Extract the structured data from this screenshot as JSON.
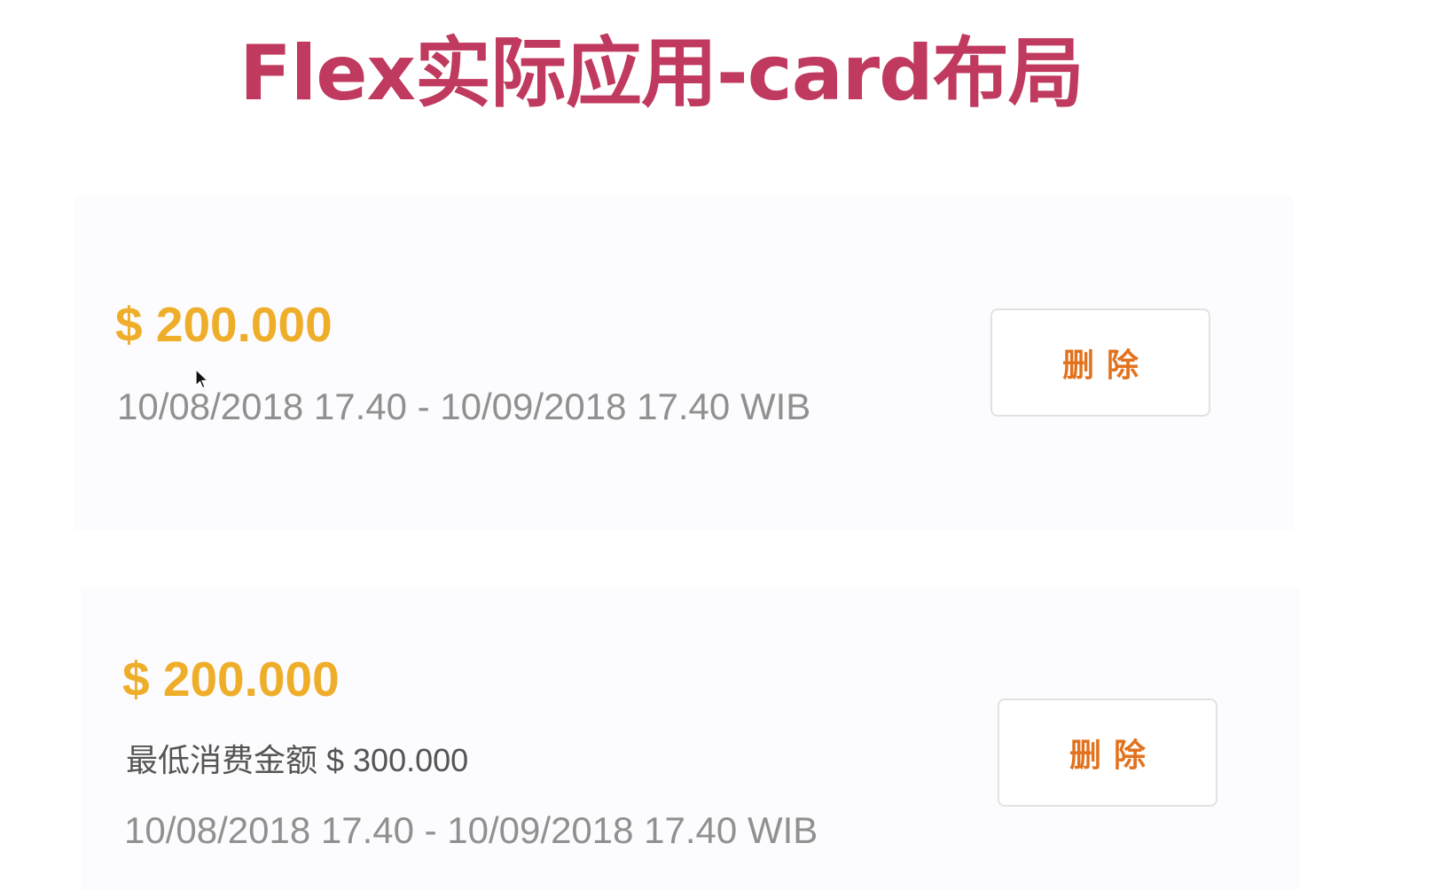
{
  "header": {
    "title": "Flex实际应用-card布局"
  },
  "cards": [
    {
      "price": "$ 200.000",
      "date_range": "10/08/2018 17.40 - 10/09/2018 17.40 WIB",
      "delete_label": "删除"
    },
    {
      "price": "$ 200.000",
      "min_spend": "最低消费金额 $ 300.000",
      "date_range": "10/08/2018 17.40 - 10/09/2018 17.40 WIB",
      "delete_label": "删除"
    }
  ],
  "colors": {
    "title": "#c0395e",
    "price": "#eeae2a",
    "button_text": "#e2721d",
    "card_background": "#fcfbfd",
    "date_text": "#909090"
  },
  "icons": {
    "cursor": "mouse-pointer-icon"
  }
}
